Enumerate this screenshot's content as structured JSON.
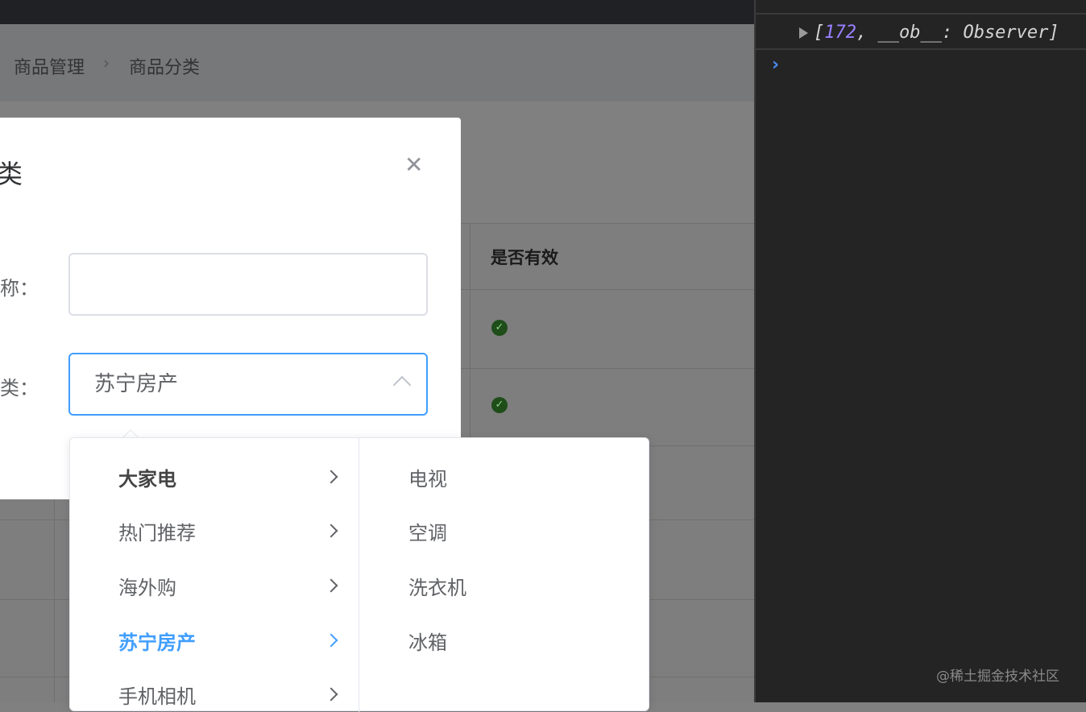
{
  "breadcrumb": [
    "商品管理",
    "商品分类"
  ],
  "table": {
    "header": "是否有效"
  },
  "dialog": {
    "title": "类",
    "label_name": "称：",
    "label_parent": "类：",
    "name_value": "",
    "parent_value": "苏宁房产"
  },
  "cascader": {
    "level1": [
      {
        "label": "大家电"
      },
      {
        "label": "热门推荐"
      },
      {
        "label": "海外购"
      },
      {
        "label": "苏宁房产",
        "active": true
      },
      {
        "label": "手机相机"
      }
    ],
    "level2": [
      "电视",
      "空调",
      "洗衣机",
      "冰箱"
    ]
  },
  "console": {
    "log_open": "[",
    "log_num": "172",
    "log_rest": ", __ob__: Observer]",
    "prompt": "›"
  },
  "watermark": "@稀土掘金技术社区",
  "colors": {
    "accent": "#409eff",
    "success": "#1e4d1a"
  }
}
